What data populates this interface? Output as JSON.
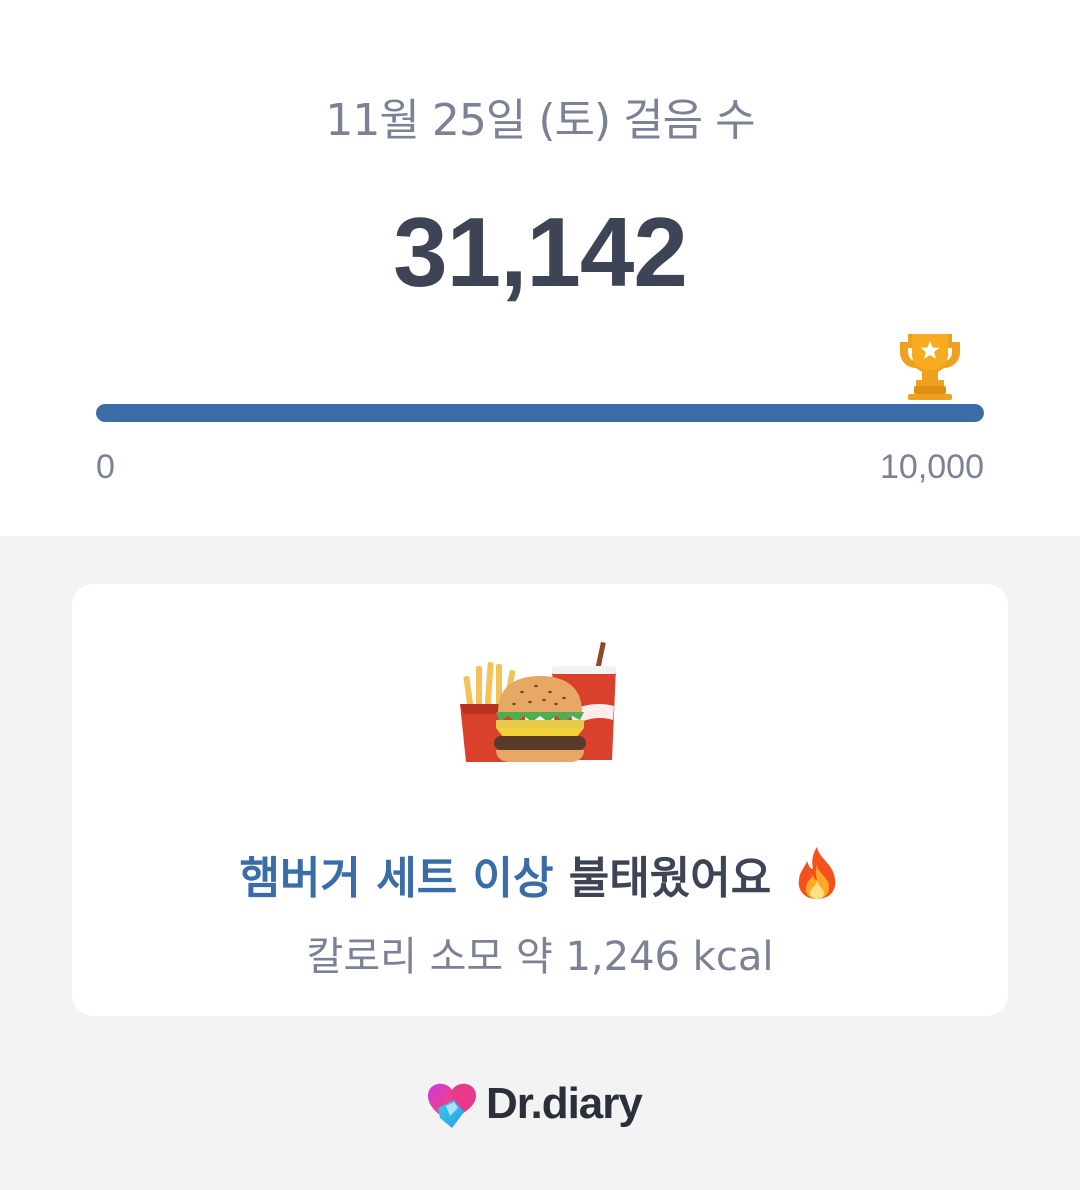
{
  "header": {
    "date_title": "11월 25일 (토) 걸음 수",
    "step_count": "31,142"
  },
  "progress": {
    "min_label": "0",
    "max_label": "10,000",
    "fraction": 1.0,
    "goal_icon": "trophy-icon",
    "bar_color": "#3a6ca8"
  },
  "card": {
    "food_icon": "hamburger-set-icon",
    "headline_highlight": "햄버거 세트 이상",
    "headline_rest": "불태웠어요",
    "headline_icon": "fire-icon",
    "subtext": "칼로리 소모 약 1,246 kcal"
  },
  "brand": {
    "name": "Dr.diary",
    "logo_icon": "heart-logo-icon"
  },
  "colors": {
    "accent": "#3a6ca8",
    "text_dark": "#3d4456",
    "text_muted": "#7b8296",
    "background": "#f3f3f3"
  }
}
